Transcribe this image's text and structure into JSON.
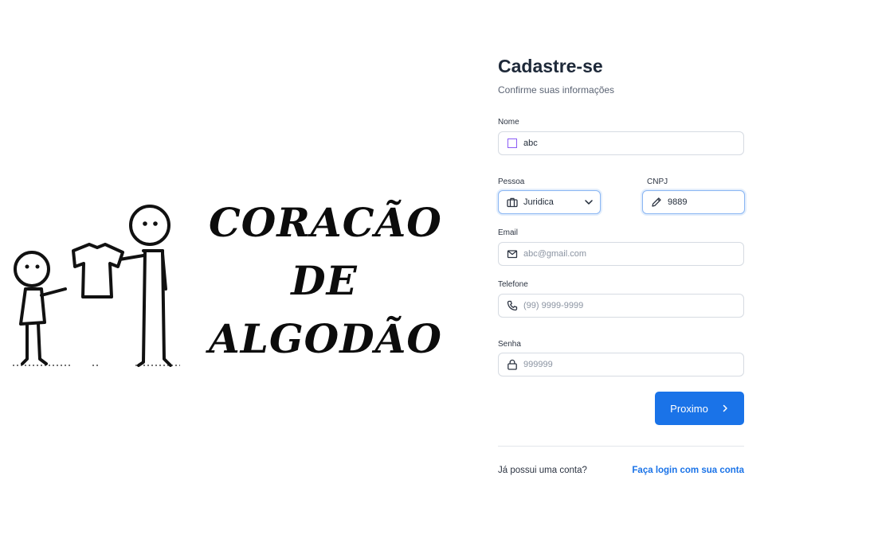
{
  "brand": {
    "lines": [
      "CORACÃO",
      "DE",
      "ALGODÃO"
    ]
  },
  "form": {
    "title": "Cadastre-se",
    "subtitle": "Confirme suas informações",
    "nome": {
      "label": "Nome",
      "value": "abc",
      "icon": "square-icon"
    },
    "pessoa": {
      "label": "Pessoa",
      "value": "Juridica",
      "icon": "briefcase-icon"
    },
    "cnpj": {
      "label": "CNPJ",
      "value": "9889",
      "icon": "pencil-icon"
    },
    "email": {
      "label": "Email",
      "placeholder": "abc@gmail.com",
      "icon": "mail-icon"
    },
    "telefone": {
      "label": "Telefone",
      "placeholder": "(99) 9999-9999",
      "icon": "phone-icon"
    },
    "senha": {
      "label": "Senha",
      "placeholder": "999999",
      "icon": "lock-icon"
    },
    "next_button": {
      "label": "Proximo",
      "icon": "chevron-right-icon"
    },
    "footer": {
      "question": "Já possui uma conta?",
      "link": "Faça login com sua conta"
    }
  },
  "colors": {
    "primary": "#1a73e8",
    "title": "#1e2939",
    "border": "#d6dbe2",
    "focus_border": "#8ab6f3"
  }
}
